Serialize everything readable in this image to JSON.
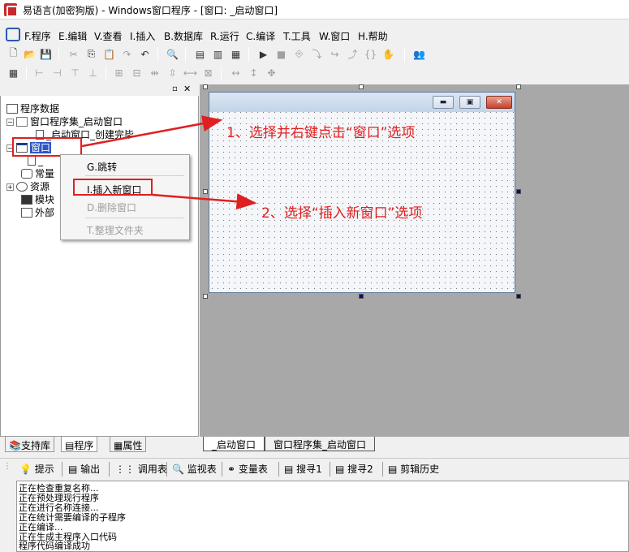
{
  "window": {
    "title": "易语言(加密狗版) - Windows窗口程序 - [窗口: _启动窗口]"
  },
  "menu": {
    "items": [
      "F.程序",
      "E.编辑",
      "V.查看",
      "I.插入",
      "B.数据库",
      "R.运行",
      "C.编译",
      "T.工具",
      "W.窗口",
      "H.帮助"
    ]
  },
  "tree": {
    "root": "程序数据",
    "window_set": "窗口程序集_启动窗口",
    "created_sub": "_启动窗口_创建完毕",
    "window": "窗口",
    "window_child": "_",
    "constants": "常量",
    "resources": "资源",
    "modules": "模块",
    "external": "外部"
  },
  "context_menu": {
    "items": [
      "G.跳转",
      "I.插入新窗口",
      "D.删除窗口",
      "T.整理文件夹"
    ]
  },
  "annotations": {
    "step1": "1、选择并右键点击“窗口”选项",
    "step2": "2、选择“插入新窗口”选项"
  },
  "form": {
    "minimize_glyph": "▬",
    "maximize_glyph": "▣",
    "close_glyph": "✕"
  },
  "left_tabs": [
    "支持库",
    "程序",
    "属性"
  ],
  "doc_tabs": [
    "_启动窗口",
    "窗口程序集_启动窗口"
  ],
  "output_tabs": [
    "提示",
    "输出",
    "调用表",
    "监视表",
    "变量表",
    "搜寻1",
    "搜寻2",
    "剪辑历史"
  ],
  "output_lines": [
    "正在检查重复名称...",
    "正在预处理现行程序",
    "正在进行名称连接...",
    "正在统计需要编译的子程序",
    "正在编译...",
    "正在生成主程序入口代码",
    "程序代码编译成功"
  ],
  "colors": {
    "annotation": "#e02020",
    "designer_bg": "#a8a8a8"
  }
}
